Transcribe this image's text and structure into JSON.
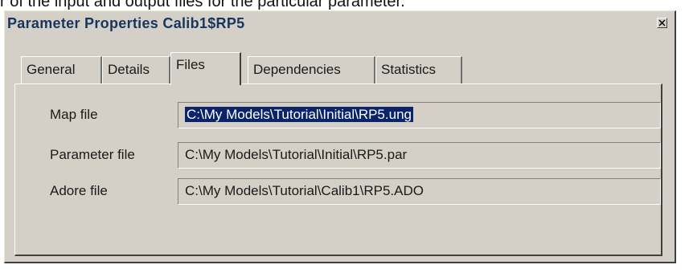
{
  "caption": "r of the input and output files for the particular parameter.",
  "dialog": {
    "title": "Parameter Properties Calib1$RP5"
  },
  "tabs": [
    {
      "label": "General"
    },
    {
      "label": "Details"
    },
    {
      "label": "Files"
    },
    {
      "label": "Dependencies"
    },
    {
      "label": "Statistics"
    }
  ],
  "active_tab": "Files",
  "files": {
    "map": {
      "label": "Map file",
      "value": "C:\\My Models\\Tutorial\\Initial\\RP5.ung"
    },
    "parameter": {
      "label": "Parameter file",
      "value": "C:\\My Models\\Tutorial\\Initial\\RP5.par"
    },
    "adore": {
      "label": "Adore file",
      "value": "C:\\My Models\\Tutorial\\Calib1\\RP5.ADO"
    }
  },
  "colors": {
    "dialog_bg": "#d4d0c8",
    "title_text": "#17365d",
    "selection_bg": "#0a246a"
  },
  "icons": {
    "close": "close-icon"
  }
}
